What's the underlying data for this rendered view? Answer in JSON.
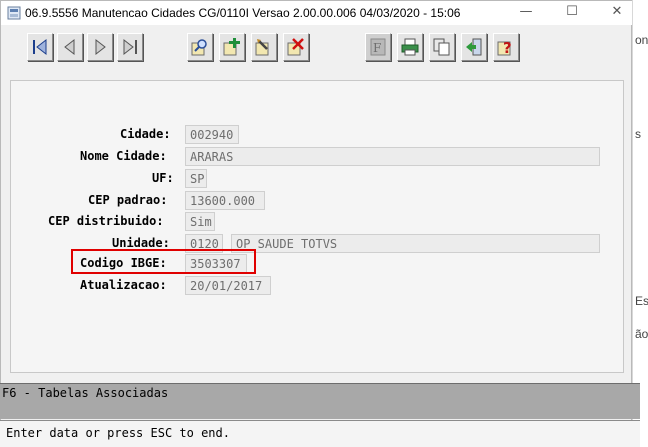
{
  "window": {
    "title": "06.9.5556 Manutencao  Cidades CG/0110I Versao 2.00.00.006 04/03/2020 - 15:06",
    "minimize": "—",
    "maximize": "☐",
    "close": "✕"
  },
  "background_window": {
    "fragments": [
      "on",
      "s",
      "Es",
      "ão"
    ]
  },
  "toolbar": {
    "buttons": [
      "first-record-icon",
      "previous-record-icon",
      "next-record-icon",
      "last-record-icon",
      "search-icon",
      "add-icon",
      "edit-icon",
      "delete-icon",
      "filter-icon",
      "print-icon",
      "copy-icon",
      "exit-icon",
      "help-icon"
    ]
  },
  "form": {
    "cidade": {
      "label": "Cidade:",
      "value": "002940"
    },
    "nome_cidade": {
      "label": "Nome Cidade:",
      "value": "ARARAS"
    },
    "uf": {
      "label": "UF:",
      "value": "SP"
    },
    "cep_padrao": {
      "label": "CEP padrao:",
      "value": "13600.000"
    },
    "cep_distribuido": {
      "label": "CEP distribuido:",
      "value": "Sim"
    },
    "unidade": {
      "label": "Unidade:",
      "code": "0120",
      "name": "OP SAUDE TOTVS"
    },
    "codigo_ibge": {
      "label": "Codigo IBGE:",
      "value": "3503307"
    },
    "atualizacao": {
      "label": "Atualizacao:",
      "value": "20/01/2017"
    }
  },
  "status": {
    "hint": "F6 - Tabelas Associadas",
    "message": "Enter data or press ESC to end."
  },
  "colors": {
    "highlight": "#e00000",
    "status_bar": "#a8a8a8"
  }
}
